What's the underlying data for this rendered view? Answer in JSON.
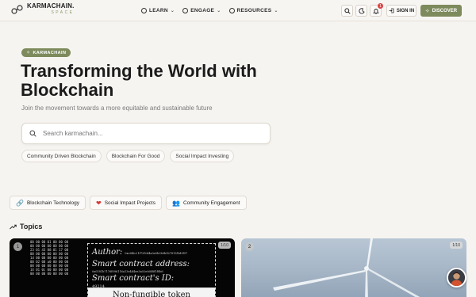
{
  "header": {
    "logo_main": "KARMACHAIN.",
    "logo_sub": "SPACE",
    "nav": [
      {
        "label": "LEARN"
      },
      {
        "label": "ENGAGE"
      },
      {
        "label": "RESOURCES"
      }
    ],
    "notification_count": "1",
    "signin_label": "SIGN IN",
    "discover_label": "DISCOVER"
  },
  "hero": {
    "tag": "KARMACHAIN",
    "headline": "Transforming the World with Blockchain",
    "subhead": "Join the movement towards a more equitable and sustainable future",
    "search_placeholder": "Search karmachain...",
    "chips": [
      "Community Driven Blockchain",
      "Blockchain For Good",
      "Social Impact Investing"
    ]
  },
  "categories": [
    {
      "label": "Blockchain Technology",
      "icon": "chain-link-icon"
    },
    {
      "label": "Social Impact Projects",
      "icon": "heart-icon"
    },
    {
      "label": "Community Engagement",
      "icon": "people-icon"
    }
  ],
  "topics": {
    "title": "Topics",
    "cards": [
      {
        "number": "1",
        "count": "1/10",
        "nft_author": "Author:",
        "nft_author_value": "0xc6f6c21f72f2d4a0a5b2b0b2b7813f0d3f57",
        "nft_contract": "Smart contract address:",
        "nft_contract_value": "0x0181b7176f096116a13e4d4ee3a02e0dd8f1f8b6",
        "nft_id_label": "Smart contract's ID:",
        "nft_id_value": "49214",
        "nft_token": "Non-fungible token"
      },
      {
        "number": "2",
        "count": "1/10"
      }
    ]
  },
  "colors": {
    "accent": "#7d8a5c",
    "background": "#f6f4f1",
    "badge": "#d64545"
  }
}
